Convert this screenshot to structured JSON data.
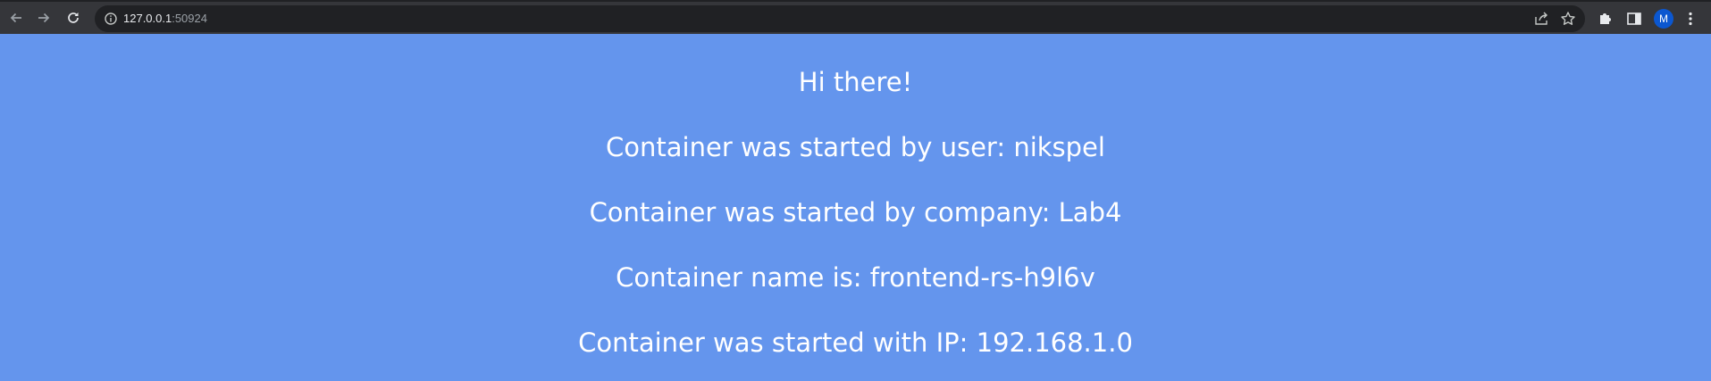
{
  "browser": {
    "url_host": "127.0.0.1",
    "url_port": ":50924",
    "profile_initial": "M",
    "icons": {
      "back": "arrow-left-icon",
      "forward": "arrow-right-icon",
      "reload": "reload-icon",
      "site_info": "info-icon",
      "share": "share-icon",
      "bookmark": "star-icon",
      "extensions": "puzzle-icon",
      "side_panel": "side-panel-icon",
      "menu": "kebab-menu-icon"
    }
  },
  "page": {
    "background_color": "#6495ed",
    "lines": [
      "Hi there!",
      "Container was started by user: nikspel",
      "Container was started by company: Lab4",
      "Container name is: frontend-rs-h9l6v",
      "Container was started with IP: 192.168.1.0"
    ]
  }
}
